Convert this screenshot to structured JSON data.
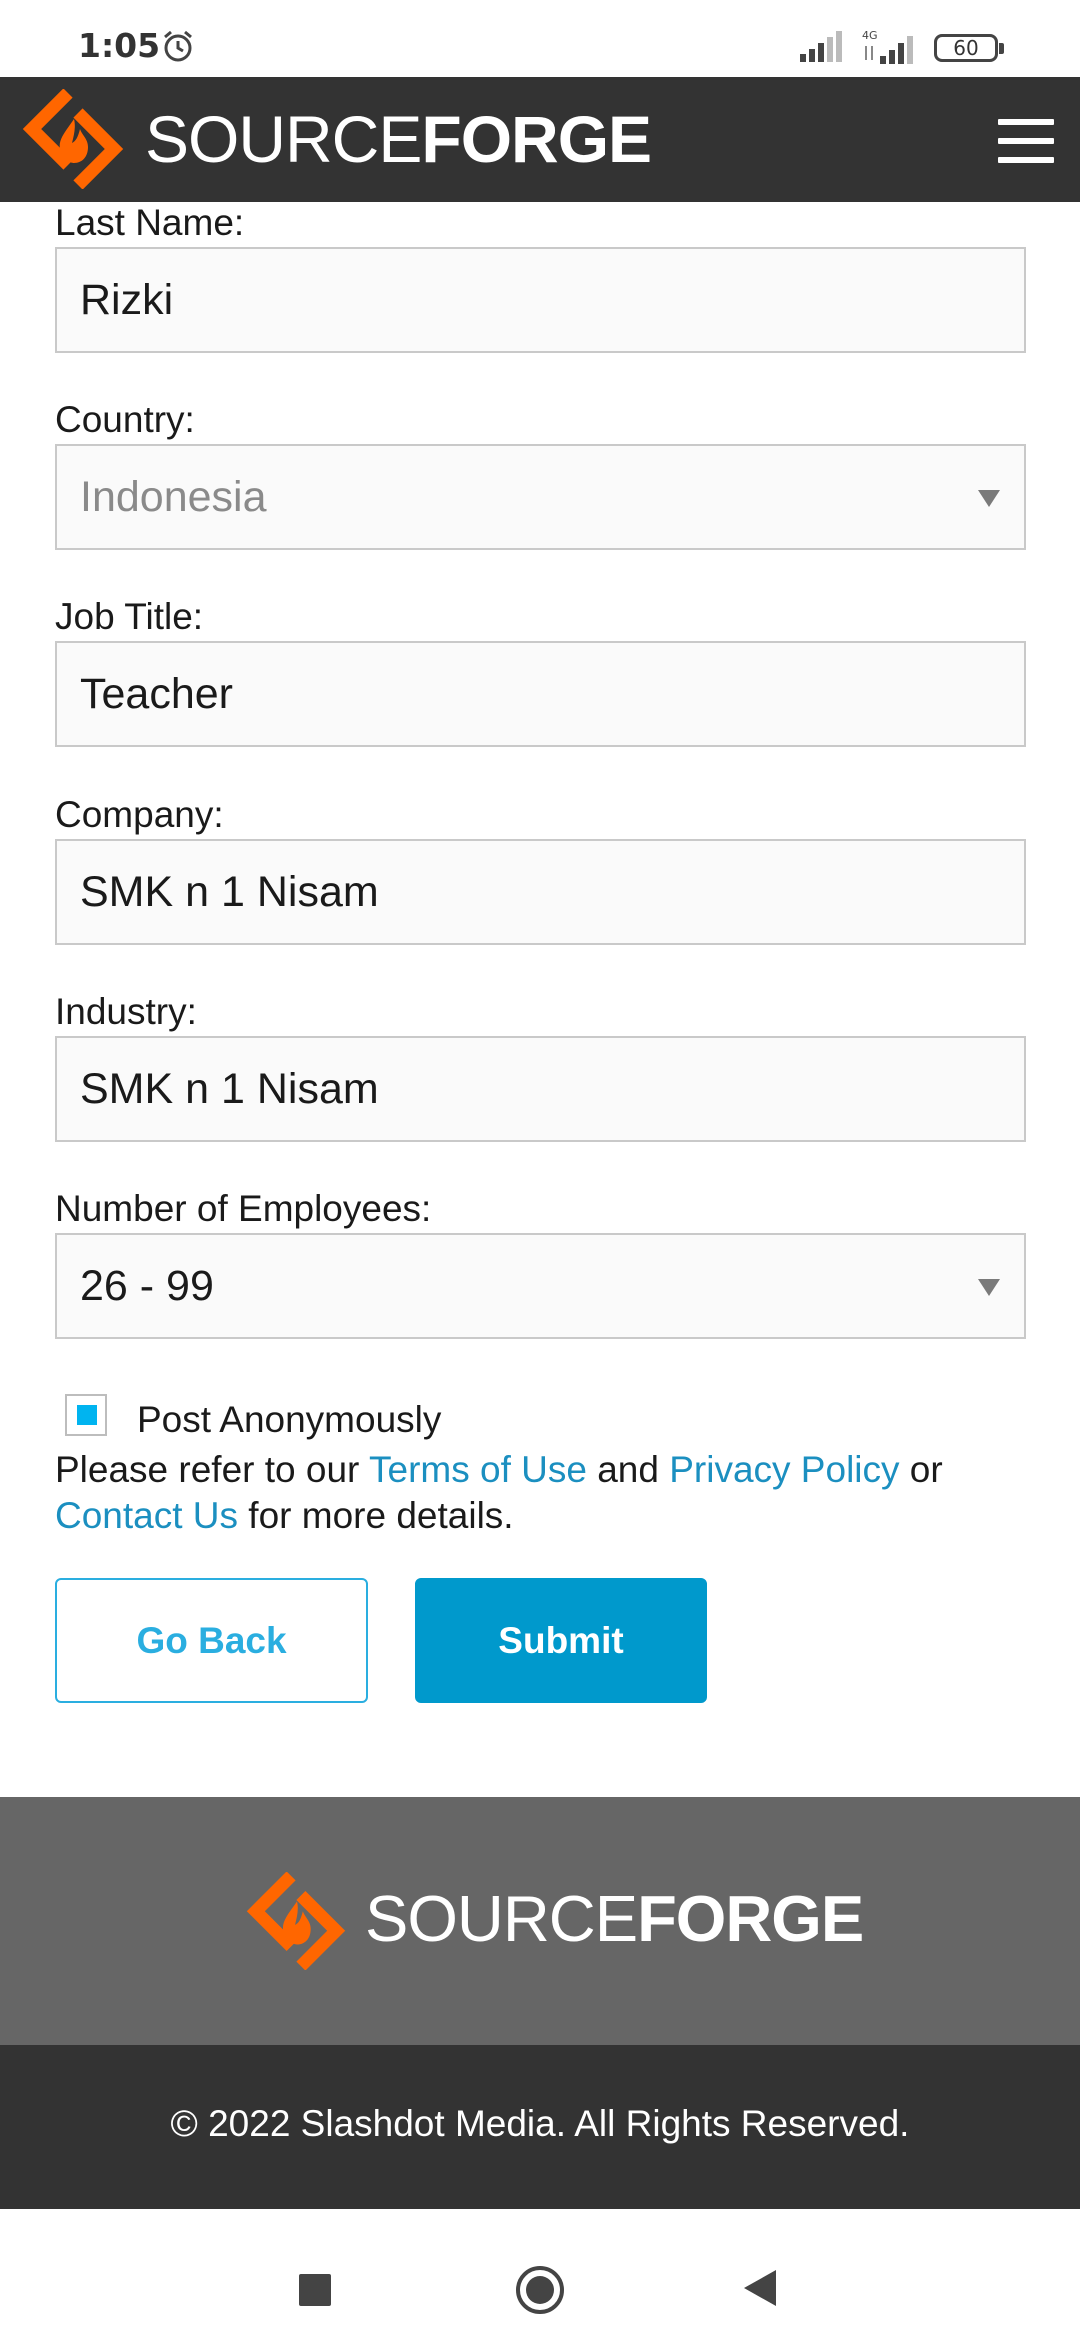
{
  "status_bar": {
    "time": "1:05",
    "battery": "60",
    "alarm_icon": "alarm-clock-icon",
    "network": "4G"
  },
  "header": {
    "logo_light": "SOURCE",
    "logo_bold": "FORGE",
    "menu_icon": "hamburger-menu-icon",
    "brand_color": "#ff6600"
  },
  "form": {
    "last_name": {
      "label": "Last Name:",
      "value": "Rizki"
    },
    "country": {
      "label": "Country:",
      "value": "Indonesia"
    },
    "job_title": {
      "label": "Job Title:",
      "value": "Teacher"
    },
    "company": {
      "label": "Company:",
      "value": "SMK n 1 Nisam"
    },
    "industry": {
      "label": "Industry:",
      "value": "SMK n 1 Nisam"
    },
    "employees": {
      "label": "Number of Employees:",
      "value": "26 - 99"
    },
    "post_anonymously": {
      "label": "Post Anonymously",
      "checked": true
    },
    "refer": {
      "prefix": "Please refer to our ",
      "terms": "Terms of Use",
      "and": " and ",
      "privacy": "Privacy Policy",
      "or": " or",
      "contact": "Contact Us",
      "suffix": " for more details."
    },
    "go_back": "Go Back",
    "submit": "Submit"
  },
  "footer": {
    "logo_light": "SOURCE",
    "logo_bold": "FORGE",
    "copyright": "© 2022 Slashdot Media. All Rights Reserved."
  },
  "colors": {
    "accent": "#0099cc",
    "link": "#1b8fc0",
    "header_bg": "#333333",
    "footer_bg": "#666666",
    "logo_orange": "#ff6600"
  }
}
